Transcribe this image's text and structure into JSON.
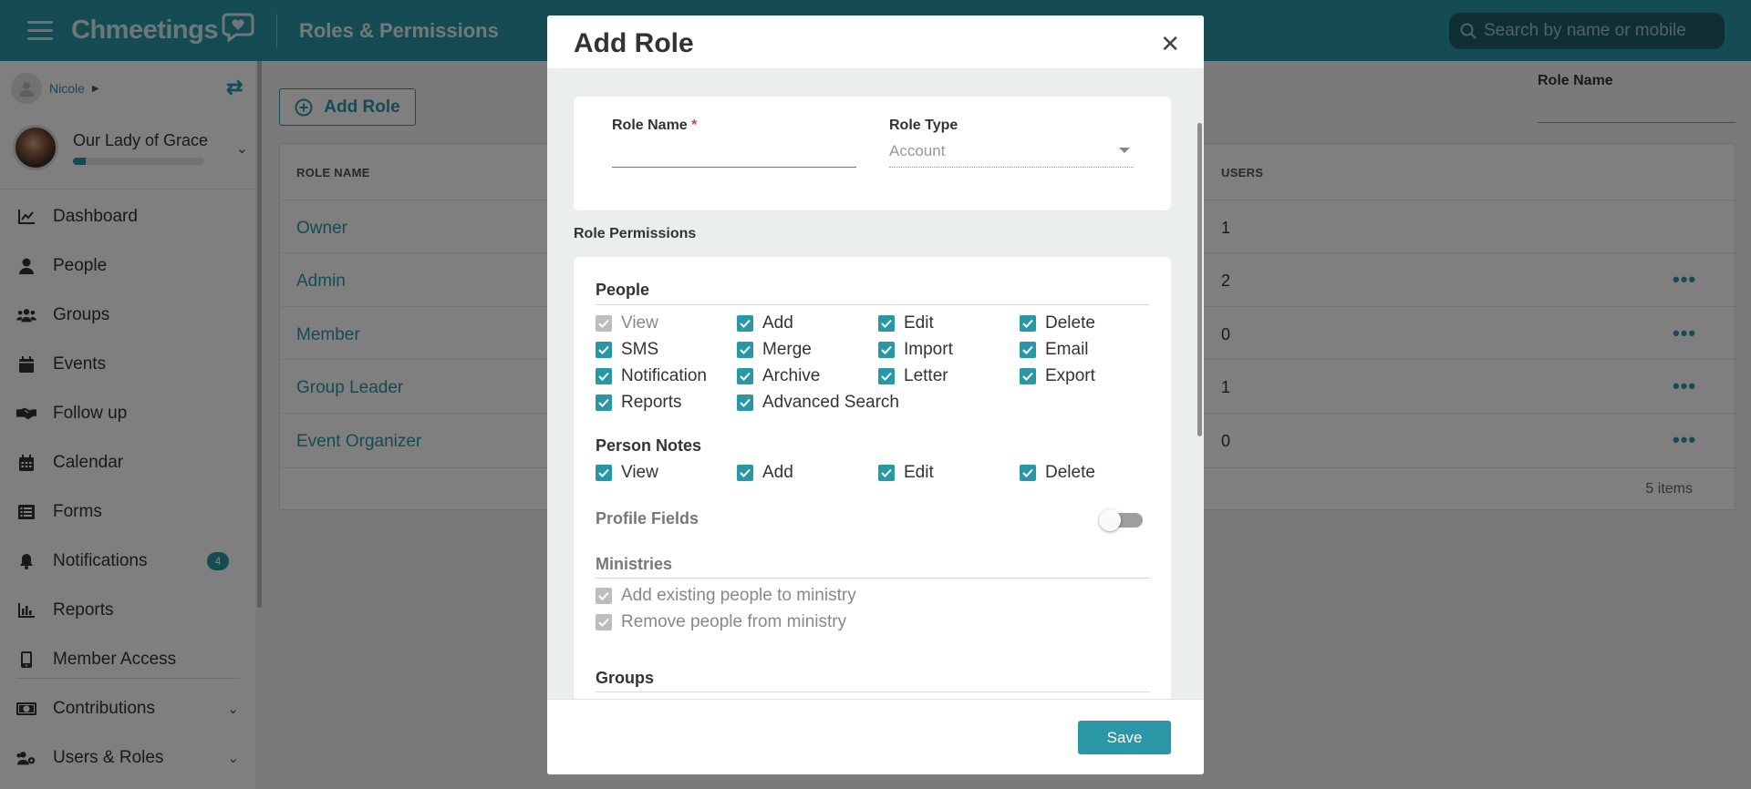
{
  "topbar": {
    "logo_text": "Chmeetings",
    "page_title": "Roles & Permissions",
    "search_placeholder": "Search by name or mobile"
  },
  "sidebar": {
    "user_name": "Nicole",
    "church_name": "Our Lady of Grace",
    "church_progress": 0.1,
    "items": [
      {
        "label": "Dashboard",
        "icon": "chart-line-icon"
      },
      {
        "label": "People",
        "icon": "person-icon"
      },
      {
        "label": "Groups",
        "icon": "users-icon"
      },
      {
        "label": "Events",
        "icon": "calendar-icon"
      },
      {
        "label": "Follow up",
        "icon": "handshake-icon"
      },
      {
        "label": "Calendar",
        "icon": "calendar-grid-icon"
      },
      {
        "label": "Forms",
        "icon": "list-icon"
      },
      {
        "label": "Notifications",
        "icon": "bell-icon",
        "badge": "4"
      },
      {
        "label": "Reports",
        "icon": "bar-chart-icon"
      },
      {
        "label": "Member Access",
        "icon": "mobile-icon"
      },
      {
        "label": "Contributions",
        "icon": "money-icon"
      },
      {
        "label": "Users & Roles",
        "icon": "users-cog-icon"
      }
    ]
  },
  "main": {
    "add_role_label": "Add Role",
    "filter_label": "Role Name",
    "table": {
      "col_role_name": "ROLE NAME",
      "col_users": "USERS",
      "rows": [
        {
          "name": "Owner",
          "users": "1"
        },
        {
          "name": "Admin",
          "users": "2"
        },
        {
          "name": "Member",
          "users": "0"
        },
        {
          "name": "Group Leader",
          "users": "1"
        },
        {
          "name": "Event Organizer",
          "users": "0"
        }
      ],
      "footer": "5 items"
    }
  },
  "modal": {
    "title": "Add Role",
    "role_name_label": "Role Name",
    "role_name_required": "*",
    "role_name_value": "",
    "role_type_label": "Role Type",
    "role_type_value": "Account",
    "permissions_title": "Role Permissions",
    "people_title": "People",
    "people_perms": [
      "View",
      "Add",
      "Edit",
      "Delete",
      "SMS",
      "Merge",
      "Import",
      "Email",
      "Notification",
      "Archive",
      "Letter",
      "Export",
      "Reports",
      "Advanced Search"
    ],
    "person_notes_title": "Person Notes",
    "person_notes_perms": [
      "View",
      "Add",
      "Edit",
      "Delete"
    ],
    "profile_fields_title": "Profile Fields",
    "ministries_title": "Ministries",
    "ministries_perms": [
      "Add existing people to ministry",
      "Remove people from ministry"
    ],
    "groups_title": "Groups",
    "save_label": "Save"
  },
  "colors": {
    "accent": "#2a97a6"
  }
}
